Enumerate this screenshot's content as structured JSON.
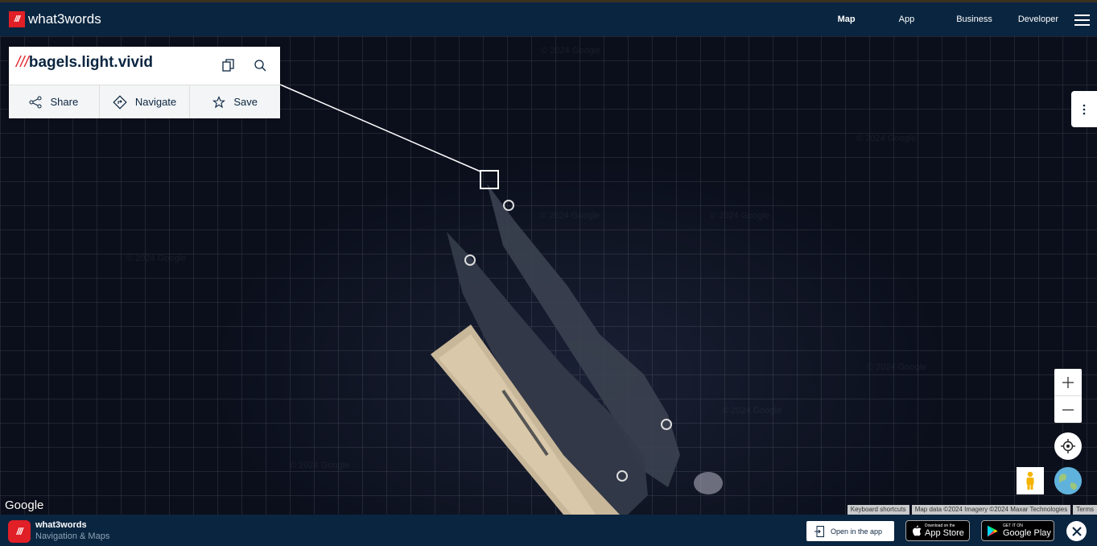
{
  "header": {
    "logo_mark": "///",
    "logo_text": "what3words",
    "nav": [
      {
        "label": "Map",
        "active": true
      },
      {
        "label": "App",
        "active": false
      },
      {
        "label": "Business",
        "active": false
      },
      {
        "label": "Developer",
        "active": false
      }
    ]
  },
  "card": {
    "slashes": "///",
    "words": "bagels.light.vivid",
    "actions": [
      "Share",
      "Navigate",
      "Save"
    ]
  },
  "map": {
    "watermark": "© 2024 Google",
    "google_logo": "Google",
    "attribution": [
      "Keyboard shortcuts",
      "Map data ©2024 Imagery ©2024 Maxar Technologies",
      "Terms"
    ]
  },
  "banner": {
    "icon": "///",
    "title": "what3words",
    "subtitle": "Navigation & Maps",
    "open_app": "Open in the app",
    "app_store_small": "Download on the",
    "app_store_big": "App Store",
    "google_play_small": "GET IT ON",
    "google_play_big": "Google Play"
  },
  "colors": {
    "brand_red": "#e11f26",
    "navy": "#0a2540"
  }
}
